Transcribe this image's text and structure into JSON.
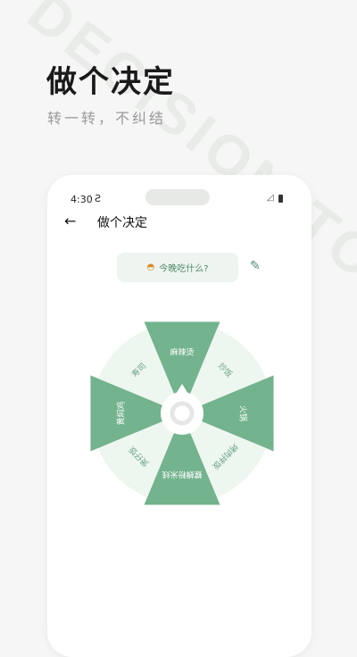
{
  "headline": "做个决定",
  "subline": "转一转，不纠结",
  "watermark": "DECISION TOO",
  "phone": {
    "status_time": "4:30",
    "toolbar_title": "做个决定",
    "question": "今晚吃什么?",
    "icons": [
      "back-arrow-icon",
      "bowl-icon",
      "edit-pencil-icon"
    ]
  },
  "wheel": {
    "colors": {
      "dark": "#73b38d",
      "light": "#eef6f0",
      "hub_ring": "#e6e6e6",
      "hub_center": "#ffffff"
    },
    "slices": [
      {
        "label": "麻辣烫",
        "style": "dark"
      },
      {
        "label": "炒饭",
        "style": "light"
      },
      {
        "label": "火锅",
        "style": "dark"
      },
      {
        "label": "烤肉拌饭",
        "style": "light"
      },
      {
        "label": "螺蛳粉米线",
        "style": "dark"
      },
      {
        "label": "煲仔饭",
        "style": "light"
      },
      {
        "label": "黄焖鸡",
        "style": "dark"
      },
      {
        "label": "寿司",
        "style": "light"
      }
    ]
  }
}
